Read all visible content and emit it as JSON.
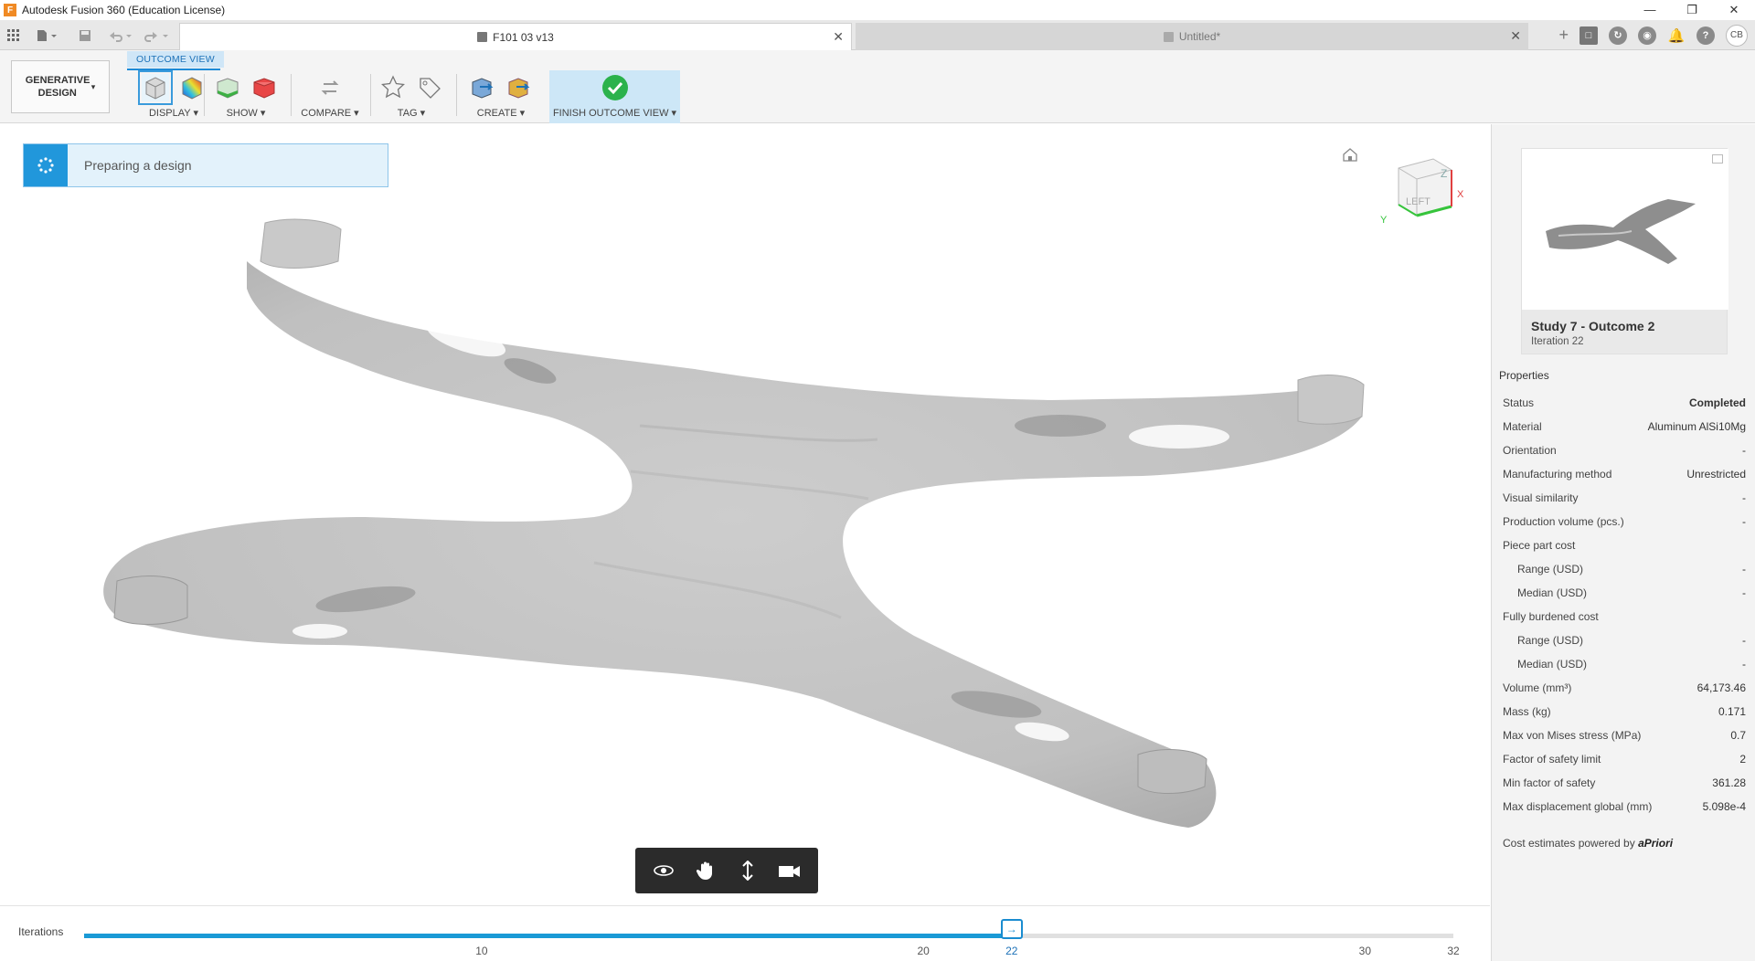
{
  "window": {
    "title": "Autodesk Fusion 360 (Education License)",
    "logo": "F"
  },
  "tabs": [
    {
      "label": "F101 03 v13"
    },
    {
      "label": "Untitled*"
    }
  ],
  "user": {
    "initials": "CB"
  },
  "toolbar": {
    "workspace_label": "GENERATIVE DESIGN",
    "mode_label": "OUTCOME VIEW",
    "groups": {
      "display": "DISPLAY",
      "show": "SHOW",
      "compare": "COMPARE",
      "tag": "TAG",
      "create": "CREATE",
      "finish": "FINISH OUTCOME VIEW"
    },
    "dropdown_arrow": "▾"
  },
  "canvas": {
    "status_text": "Preparing a design",
    "viewcube_face": "LEFT",
    "viewcube_axes": {
      "z": "Z",
      "x": "X",
      "y": "Y"
    }
  },
  "iterations": {
    "label": "Iterations",
    "min": 1,
    "max": 32,
    "current": 22,
    "ticks": [
      10,
      20,
      22,
      30,
      32
    ]
  },
  "outcome": {
    "title": "Study 7 - Outcome 2",
    "subtitle": "Iteration 22"
  },
  "properties": {
    "heading": "Properties",
    "rows": [
      {
        "key": "Status",
        "value": "Completed",
        "bold": true
      },
      {
        "key": "Material",
        "value": "Aluminum AlSi10Mg"
      },
      {
        "key": "Orientation",
        "value": "-"
      },
      {
        "key": "Manufacturing method",
        "value": "Unrestricted"
      },
      {
        "key": "Visual similarity",
        "value": "-"
      },
      {
        "key": "Production volume (pcs.)",
        "value": "-"
      },
      {
        "key": "Piece part cost",
        "value": ""
      },
      {
        "key": "Range (USD)",
        "value": "-",
        "indent": true
      },
      {
        "key": "Median (USD)",
        "value": "-",
        "indent": true
      },
      {
        "key": "Fully burdened cost",
        "value": ""
      },
      {
        "key": "Range (USD)",
        "value": "-",
        "indent": true
      },
      {
        "key": "Median (USD)",
        "value": "-",
        "indent": true
      },
      {
        "key": "Volume (mm³)",
        "value": "64,173.46"
      },
      {
        "key": "Mass (kg)",
        "value": "0.171"
      },
      {
        "key": "Max von Mises stress (MPa)",
        "value": "0.7"
      },
      {
        "key": "Factor of safety limit",
        "value": "2"
      },
      {
        "key": "Min factor of safety",
        "value": "361.28"
      },
      {
        "key": "Max displacement global (mm)",
        "value": "5.098e-4"
      }
    ],
    "cost_note": "Cost estimates powered by",
    "cost_brand": "aPriori"
  },
  "colors": {
    "accent": "#1a9ad6",
    "finish_green": "#2bb24c",
    "model_gray": "#c4c4c4"
  }
}
